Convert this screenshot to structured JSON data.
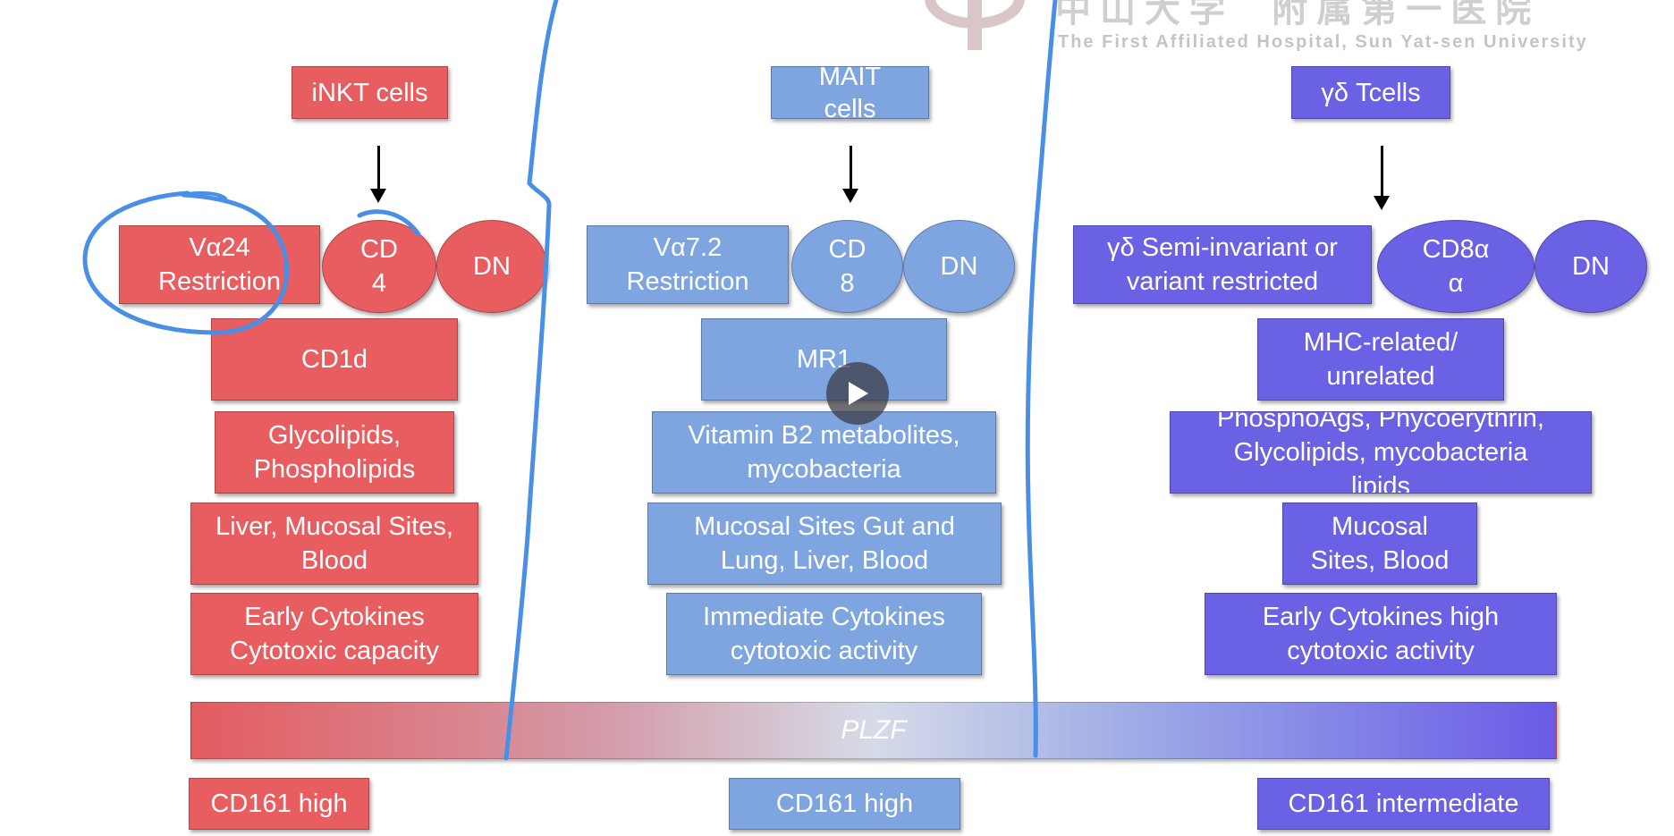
{
  "watermark": {
    "cn_text": "中山大学  附属第一医院",
    "en_text": "The First Affiliated Hospital, Sun Yat-sen University"
  },
  "columns": [
    {
      "key": "inkt",
      "color": "#e85e60",
      "header": "iNKT cells",
      "restriction": "Vα24\nRestriction",
      "coreceptor": "CD\n4",
      "dn": "DN",
      "molecule": "CD1d",
      "antigens": "Glycolipids,\nPhospholipids",
      "location": "Liver, Mucosal Sites,\nBlood",
      "function": "Early Cytokines\nCytotoxic capacity",
      "cd161": "CD161 high"
    },
    {
      "key": "mait",
      "color": "#7ea5e0",
      "header": "MAIT\ncells",
      "restriction": "Vα7.2\nRestriction",
      "coreceptor": "CD\n8",
      "dn": "DN",
      "molecule": "MR1",
      "antigens": "Vitamin B2 metabolites,\nmycobacteria",
      "location": "Mucosal Sites Gut and\nLung, Liver, Blood",
      "function": "Immediate Cytokines\ncytotoxic activity",
      "cd161": "CD161 high"
    },
    {
      "key": "gd",
      "color": "#6b61e4",
      "header": "γδ Tcells",
      "restriction": "γδ Semi-invariant or\nvariant restricted",
      "coreceptor": "CD8α\nα",
      "dn": "DN",
      "molecule": "MHC-related/\nunrelated",
      "antigens": "PhosphoAgs, Phycoerythrin,\nGlycolipids, mycobacteria\nlipids",
      "location": "Mucosal\nSites, Blood",
      "function": "Early Cytokines high\ncytotoxic activity",
      "cd161": "CD161 intermediate"
    }
  ],
  "plzf_label": "PLZF",
  "annotation_color": "#4a8fe6",
  "play_icon": "play-icon"
}
